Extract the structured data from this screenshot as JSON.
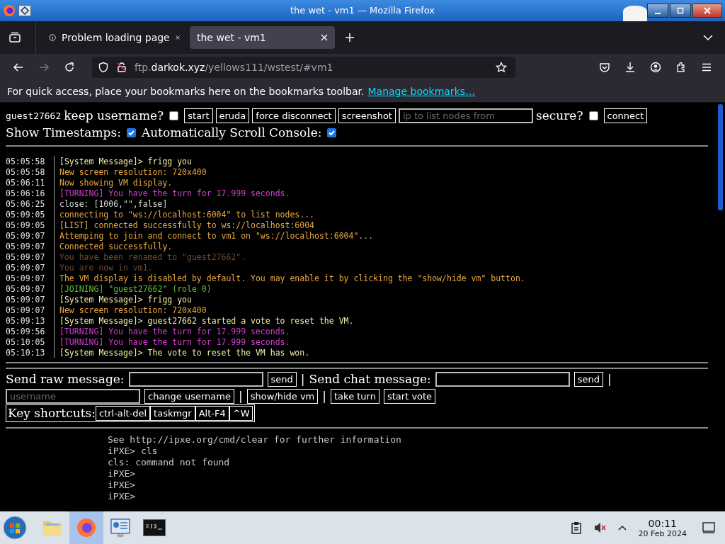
{
  "window": {
    "title": "the wet - vm1 — Mozilla Firefox"
  },
  "tabs": [
    {
      "label": "Problem loading page",
      "selected": false,
      "kind": "info"
    },
    {
      "label": "the wet - vm1",
      "selected": true,
      "kind": "plain"
    }
  ],
  "address_bar": {
    "url": "ftp.**darkok.xyz**/yellows111/wstest/#vm1"
  },
  "bookmarks_bar": {
    "message": "For quick access, place your bookmarks here on the bookmarks toolbar.",
    "link": "Manage bookmarks…"
  },
  "controls": {
    "username": "guest27662",
    "keep_username": {
      "label": "keep username?",
      "checked": false
    },
    "buttons": [
      "start",
      "eruda",
      "force disconnect",
      "screenshot"
    ],
    "ip_field": {
      "placeholder": "ip to list nodes from"
    },
    "secure": {
      "label": "secure?",
      "checked": false
    },
    "connect": "connect",
    "show_timestamps": {
      "label": "Show Timestamps:",
      "checked": true
    },
    "auto_scroll": {
      "label": "Automatically Scroll Console:",
      "checked": true
    }
  },
  "console": {
    "lines": [
      {
        "time": "05:05:58",
        "text": "[System Message]> frigg you",
        "color": "#f2eaa8"
      },
      {
        "time": "05:05:58",
        "text": "New screen resolution: 720x400",
        "color": "#e8a640"
      },
      {
        "time": "05:06:11",
        "text": "Now showing VM display.",
        "color": "#e8a640"
      },
      {
        "time": "05:06:16",
        "text": "[TURNING] You have the turn for 17.999 seconds.",
        "color": "#d23ed2"
      },
      {
        "time": "05:06:25",
        "text": "close: [1006,\"\",false]",
        "color": "#dddddd"
      },
      {
        "time": "05:09:05",
        "text": "connecting to \"ws://localhost:6004\" to list nodes...",
        "color": "#e8a640"
      },
      {
        "time": "05:09:05",
        "text": "[LIST] connected successfully to ws://localhost:6004",
        "color": "#e8a640"
      },
      {
        "time": "05:09:07",
        "text": "Attemping to join and connect to vm1 on \"ws://localhost:6004\"...",
        "color": "#e8a640"
      },
      {
        "time": "05:09:07",
        "text": "Connected successfully.",
        "color": "#e8a640"
      },
      {
        "time": "05:09:07",
        "text": "You have been renamed to \"guest27662\".",
        "color": "#6e4a30"
      },
      {
        "time": "05:09:07",
        "text": "You are now in vm1.",
        "color": "#6e4a30"
      },
      {
        "time": "05:09:07",
        "text": "The VM display is disabled by default. You may enable it by clicking the \"show/hide vm\" button.",
        "color": "#e8a640"
      },
      {
        "time": "05:09:07",
        "text": "[JOINING] \"guest27662\" (role 0)",
        "color": "#5fc02e"
      },
      {
        "time": "05:09:07",
        "text": "[System Message]> frigg you",
        "color": "#f2eaa8"
      },
      {
        "time": "05:09:07",
        "text": "New screen resolution: 720x400",
        "color": "#e8a640"
      },
      {
        "time": "05:09:13",
        "text": "[System Message]> guest27662 started a vote to reset the VM.",
        "color": "#f2eaa8"
      },
      {
        "time": "05:09:56",
        "text": "[TURNING] You have the turn for 17.999 seconds.",
        "color": "#d23ed2"
      },
      {
        "time": "05:10:05",
        "text": "[TURNING] You have the turn for 17.999 seconds.",
        "color": "#d23ed2"
      },
      {
        "time": "05:10:13",
        "text": "[System Message]> The vote to reset the VM has won.",
        "color": "#f2eaa8"
      }
    ]
  },
  "message_row": {
    "raw_label": "Send raw message:",
    "raw_send": "send",
    "separator_1": "|",
    "chat_label": "Send chat message:",
    "chat_send": "send",
    "separator_2": "|"
  },
  "user_row": {
    "username_field": {
      "placeholder": "username"
    },
    "change_username": "change username",
    "separator_1": "|",
    "show_hide_vm": "show/hide vm",
    "separator_2": "|",
    "take_turn": "take turn",
    "start_vote": "start vote"
  },
  "key_shortcuts": {
    "label": "Key shortcuts:",
    "buttons": [
      "ctrl-alt-del",
      "taskmgr",
      "Alt-F4",
      "^W"
    ]
  },
  "vm_screen": {
    "lines": [
      "See http://ipxe.org/cmd/clear for further information",
      "iPXE> cls",
      "cls: command not found",
      "iPXE>",
      "iPXE>",
      "iPXE>"
    ]
  },
  "taskbar": {
    "apps": [
      {
        "kind": "folder",
        "selected": false
      },
      {
        "kind": "browser",
        "selected": true
      },
      {
        "kind": "network",
        "selected": false
      },
      {
        "kind": "terminal",
        "selected": false
      }
    ],
    "time": "00:11",
    "date": "20 Feb 2024"
  }
}
